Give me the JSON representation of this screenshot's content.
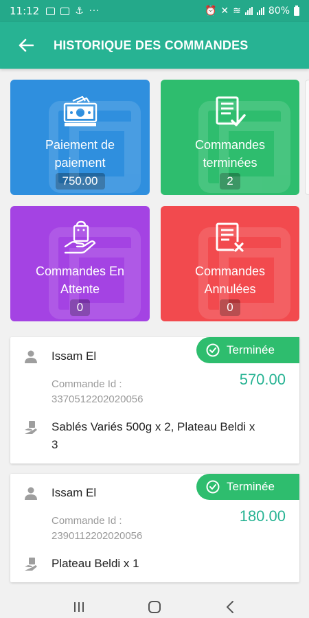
{
  "status_bar": {
    "time": "11:12",
    "dots": "···",
    "battery": "80%"
  },
  "header": {
    "title": "HISTORIQUE DES COMMANDES"
  },
  "stats": {
    "payment": {
      "label": "Paiement de paiement",
      "value": "750.00"
    },
    "completed": {
      "label": "Commandes terminées",
      "value": "2"
    },
    "pending": {
      "label": "Commandes En Attente",
      "value": "0"
    },
    "cancelled": {
      "label": "Commandes Annulées",
      "value": "0"
    }
  },
  "orders": [
    {
      "customer": "Issam El",
      "order_id_label": "Commande Id :",
      "order_id": "3370512202020056",
      "items": "Sablés Variés 500g x 2, Plateau Beldi x 3",
      "amount": "570.00",
      "status": "Terminée"
    },
    {
      "customer": "Issam El",
      "order_id_label": "Commande Id :",
      "order_id": "2390112202020056",
      "items": "Plateau Beldi x 1",
      "amount": "180.00",
      "status": "Terminée"
    }
  ],
  "colors": {
    "header": "#27b393",
    "status_bar": "#24a98a",
    "payment_card": "#2f8fde",
    "completed_card": "#2ebd6e",
    "pending_card": "#a443e3",
    "cancelled_card": "#f24a4e",
    "amount": "#27b393",
    "status_badge": "#2ebd6e"
  },
  "icons": {
    "back": "arrow-left-icon",
    "payment": "money-hand-icon",
    "completed": "document-check-icon",
    "pending": "bag-hand-icon",
    "cancelled": "document-x-icon",
    "customer": "person-icon",
    "items": "hand-bag-icon",
    "status": "check-circle-icon"
  }
}
